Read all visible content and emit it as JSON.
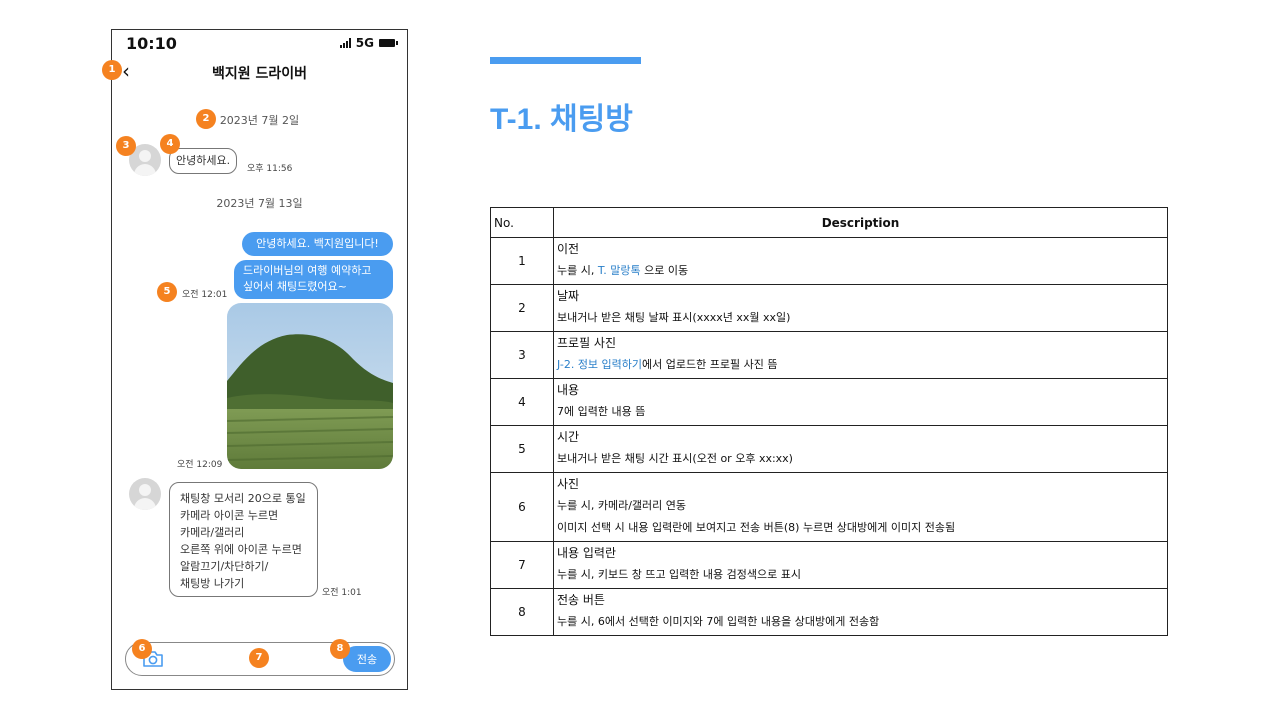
{
  "phone": {
    "status_time": "10:10",
    "network": "5G",
    "header_title": "백지원 드라이버",
    "back_glyph": "‹",
    "date1": "2023년 7월 2일",
    "msg1": {
      "text": "안녕하세요.",
      "time": "오후 11:56"
    },
    "date2": "2023년 7월 13일",
    "out1": "안녕하세요. 백지원입니다!",
    "out2_line1": "드라이버님의 여행 예약하고",
    "out2_line2": "싶어서 채팅드렸어요~",
    "out2_time": "오전 12:01",
    "photo_time": "오전 12:09",
    "msg2": {
      "lines": [
        "채팅창 모서리 20으로 통일",
        "카메라 아이콘 누르면",
        "카메라/갤러리",
        "오른쪽 위에 아이콘 누르면",
        "알람끄기/차단하기/",
        "채팅방 나가기"
      ],
      "time": "오전 1:01"
    },
    "send_label": "전송"
  },
  "badges": [
    "1",
    "2",
    "3",
    "4",
    "5",
    "6",
    "7",
    "8"
  ],
  "page": {
    "heading": "T-1. 채팅방",
    "accent_color": "#4a9cf0",
    "badge_color": "#f58220"
  },
  "table": {
    "col_no": "No.",
    "col_desc": "Description",
    "rows": [
      {
        "no": "1",
        "title": "이전",
        "lines": [
          [
            "누를 시, ",
            "T. 말랑톡",
            " 으로 이동"
          ]
        ]
      },
      {
        "no": "2",
        "title": "날짜",
        "lines": [
          [
            "보내거나 받은 채팅 날짜 표시(xxxx년  xx월  xx일)"
          ]
        ]
      },
      {
        "no": "3",
        "title": "프로필 사진",
        "lines": [
          [
            "",
            "J-2. 정보 입력하기",
            "에서 업로드한 프로필 사진 뜸"
          ]
        ]
      },
      {
        "no": "4",
        "title": "내용",
        "lines": [
          [
            "7에 입력한 내용 뜸"
          ]
        ]
      },
      {
        "no": "5",
        "title": "시간",
        "lines": [
          [
            "보내거나 받은 채팅 시간 표시(오전  or 오후  xx:xx)"
          ]
        ]
      },
      {
        "no": "6",
        "title": "사진",
        "lines": [
          [
            "누를 시, 카메라/갤러리 연동"
          ],
          [
            "이미지 선택 시 내용 입력란에 보여지고 전송 버튼(8) 누르면 상대방에게 이미지 전송됨"
          ]
        ]
      },
      {
        "no": "7",
        "title": "내용 입력란",
        "lines": [
          [
            "누를 시, 키보드 창 뜨고 입력한 내용 검정색으로 표시"
          ]
        ]
      },
      {
        "no": "8",
        "title": "전송 버튼",
        "lines": [
          [
            "누를 시, 6에서 선택한 이미지와  7에 입력한 내용을 상대방에게 전송함"
          ]
        ]
      }
    ]
  }
}
